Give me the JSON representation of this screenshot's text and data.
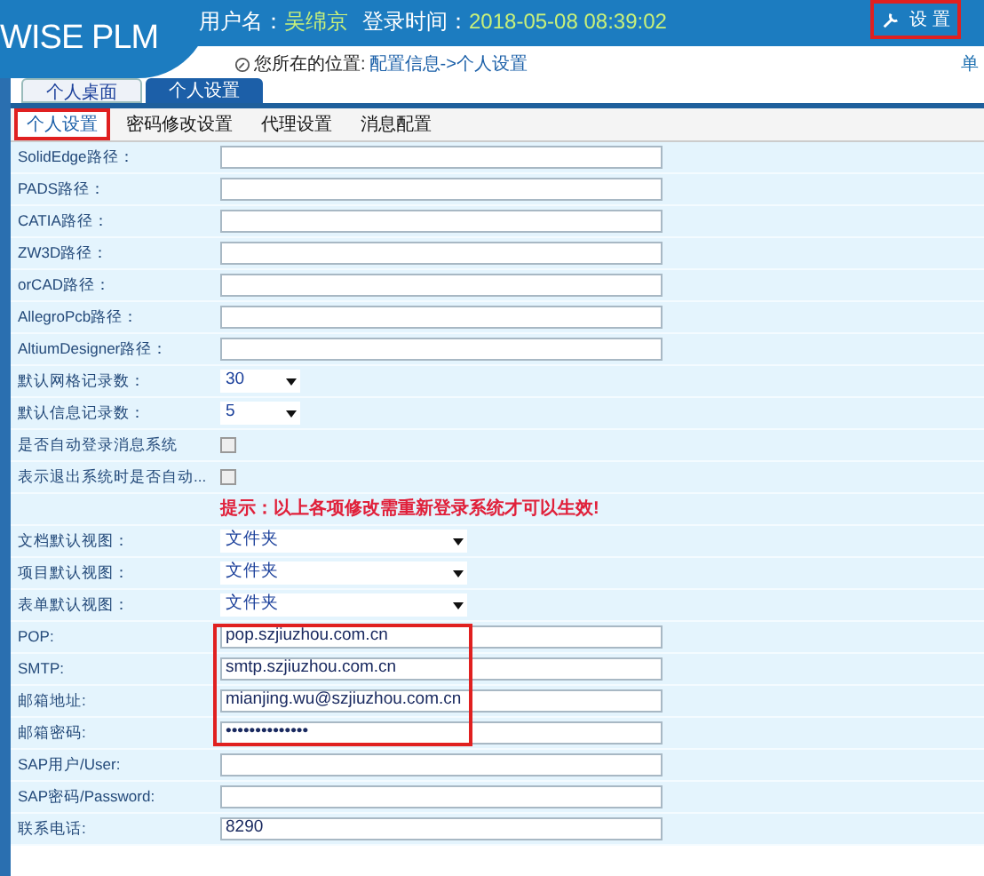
{
  "logo": "WISE PLM",
  "header": {
    "user_label": "用户名：",
    "user": "吴绵京",
    "login_label": "登录时间：",
    "login_time": "2018-05-08 08:39:02",
    "settings": {
      "label": "设 置",
      "highlighted": true
    },
    "cut_link": "单"
  },
  "breadcrumb": {
    "label": "您所在的位置:",
    "path": "配置信息->个人设置"
  },
  "tabs": [
    {
      "label": "个人桌面",
      "selected": false
    },
    {
      "label": "个人设置",
      "selected": true
    }
  ],
  "subtabs": [
    {
      "label": "个人设置",
      "selected": true,
      "highlighted": true
    },
    {
      "label": "密码修改设置",
      "selected": false,
      "highlighted": false
    },
    {
      "label": "代理设置",
      "selected": false,
      "highlighted": false
    },
    {
      "label": "消息配置",
      "selected": false,
      "highlighted": false
    }
  ],
  "rows": [
    {
      "kind": "text",
      "label": "SolidEdge路径：",
      "value": ""
    },
    {
      "kind": "text",
      "label": "PADS路径：",
      "value": ""
    },
    {
      "kind": "text",
      "label": "CATIA路径：",
      "value": ""
    },
    {
      "kind": "text",
      "label": "ZW3D路径：",
      "value": ""
    },
    {
      "kind": "text",
      "label": "orCAD路径：",
      "value": ""
    },
    {
      "kind": "text",
      "label": "AllegroPcb路径：",
      "value": ""
    },
    {
      "kind": "text",
      "label": "AltiumDesigner路径：",
      "value": ""
    },
    {
      "kind": "select",
      "label": "默认网格记录数：",
      "value": "30",
      "wide": false
    },
    {
      "kind": "select",
      "label": "默认信息记录数：",
      "value": "5",
      "wide": false
    },
    {
      "kind": "checkbox",
      "label": "是否自动登录消息系统",
      "checked": false
    },
    {
      "kind": "checkbox",
      "label": "表示退出系统时是否自动...",
      "checked": false
    },
    {
      "kind": "notice",
      "label": "提示：以上各项修改需重新登录系统才可以生效!"
    },
    {
      "kind": "select",
      "label": "文档默认视图：",
      "value": "文件夹",
      "wide": true
    },
    {
      "kind": "select",
      "label": "项目默认视图：",
      "value": "文件夹",
      "wide": true
    },
    {
      "kind": "select",
      "label": "表单默认视图：",
      "value": "文件夹",
      "wide": true
    },
    {
      "kind": "text",
      "label": "POP:",
      "value": "pop.szjiuzhou.com.cn",
      "highlighted": true
    },
    {
      "kind": "text",
      "label": "SMTP:",
      "value": "smtp.szjiuzhou.com.cn",
      "highlighted": true
    },
    {
      "kind": "text",
      "label": "邮箱地址:",
      "value": "mianjing.wu@szjiuzhou.com.cn",
      "highlighted": true
    },
    {
      "kind": "text",
      "label": "邮箱密码:",
      "value": "••••••••••••••",
      "highlighted": true
    },
    {
      "kind": "text",
      "label": "SAP用户/User:",
      "value": ""
    },
    {
      "kind": "text",
      "label": "SAP密码/Password:",
      "value": ""
    },
    {
      "kind": "text",
      "label": "联系电话:",
      "value": "8290"
    }
  ]
}
